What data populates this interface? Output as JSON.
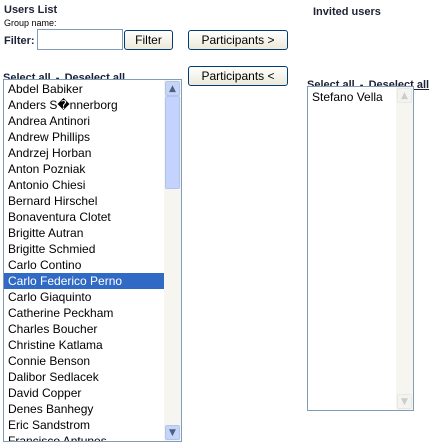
{
  "users_list": {
    "title": "Users List",
    "group_name_label": "Group name:",
    "filter_label": "Filter:",
    "filter_value": "",
    "filter_button": "Filter",
    "select_all": "Select all",
    "separator": "-",
    "deselect_all": "Deselect all",
    "items": [
      "Abdel Babiker",
      "Anders S�nnerborg",
      "Andrea Antinori",
      "Andrew Phillips",
      "Andrzej Horban",
      "Anton Pozniak",
      "Antonio Chiesi",
      "Bernard Hirschel",
      "Bonaventura Clotet",
      "Brigitte Autran",
      "Brigitte Schmied",
      "Carlo Contino",
      "Carlo Federico Perno",
      "Carlo Giaquinto",
      "Catherine Peckham",
      "Charles Boucher",
      "Christine Katlama",
      "Connie Benson",
      "Dalibor Sedlacek",
      "David Copper",
      "Denes Banhegy",
      "Eric Sandstrom",
      "Francisco Antunes"
    ],
    "selected_item": "Carlo Federico Perno"
  },
  "actions": {
    "add_participants": "Participants >",
    "remove_participants": "Participants <"
  },
  "invited_users": {
    "title": "Invited users",
    "select_all": "Select all",
    "separator": "-",
    "deselect_all": "Deselect all",
    "items": [
      "Stefano Vella"
    ]
  },
  "colors": {
    "selection": "#316ac5",
    "heading": "#1d2136",
    "border": "#7f9db9"
  }
}
